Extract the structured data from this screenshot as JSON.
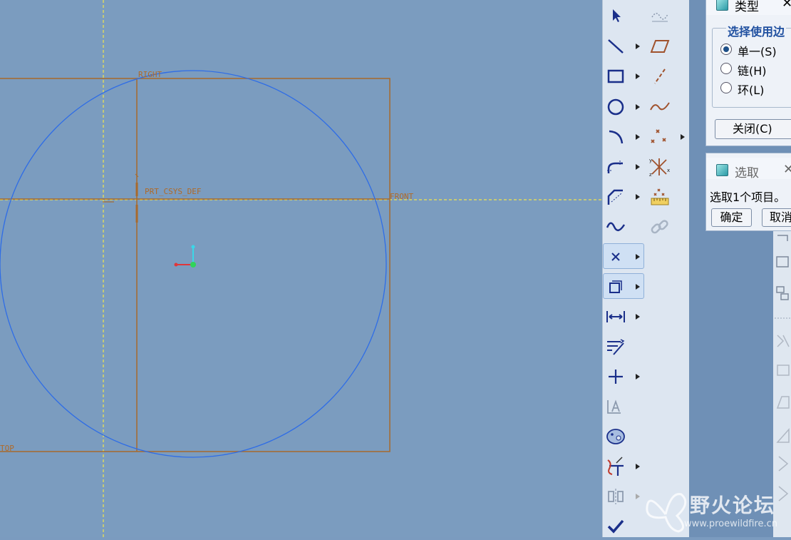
{
  "canvas": {
    "datums": {
      "right": "RIGHT",
      "front": "FRONT",
      "top": "TOP",
      "csys": "PRT_CSYS_DEF"
    }
  },
  "toolbar": {
    "items": [
      {
        "icon": "select-arrow-icon"
      },
      {
        "icon": "line-icon"
      },
      {
        "icon": "rectangle-icon"
      },
      {
        "icon": "circle-icon"
      },
      {
        "icon": "arc-icon"
      },
      {
        "icon": "fillet-icon"
      },
      {
        "icon": "chamfer-icon"
      },
      {
        "icon": "spline-icon"
      },
      {
        "icon": "point-icon"
      },
      {
        "icon": "offset-edge-icon"
      },
      {
        "icon": "dimension-icon"
      },
      {
        "icon": "modify-icon"
      },
      {
        "icon": "constraint-icon"
      },
      {
        "icon": "text-icon"
      },
      {
        "icon": "palette-icon"
      },
      {
        "icon": "trim-icon"
      },
      {
        "icon": "mirror-icon"
      },
      {
        "icon": "done-check-icon"
      }
    ]
  },
  "type_dialog": {
    "title": "类型",
    "group_label": "选择使用边",
    "options": [
      {
        "label": "单一(S)",
        "selected": true
      },
      {
        "label": "链(H)",
        "selected": false
      },
      {
        "label": "环(L)",
        "selected": false
      }
    ],
    "close_label": "关闭(C)"
  },
  "select_dialog": {
    "title": "选取",
    "message": "选取1个项目。",
    "ok_label": "确定",
    "cancel_label": "取消"
  },
  "watermark": {
    "name": "野火论坛",
    "url": "www.proewildfire.cn"
  }
}
